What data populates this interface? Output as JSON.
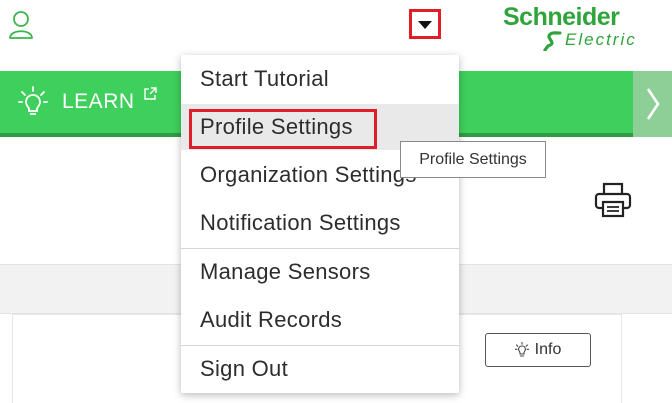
{
  "header": {
    "user_icon": "user-icon",
    "menu_trigger_icon": "caret-down-icon",
    "logo": {
      "line1": "Schneider",
      "line2": "Electric"
    },
    "accent_red": "#e01e2a",
    "brand_green": "#2fa43b"
  },
  "nav": {
    "learn_label": "LEARN",
    "learn_icon": "lightbulb-icon",
    "external_icon": "external-link-icon",
    "next_icon": "chevron-right-icon",
    "bar_color": "#3ecf5c"
  },
  "dropdown": {
    "items": [
      {
        "label": "Start Tutorial"
      },
      {
        "label": "Profile Settings"
      },
      {
        "label": "Organization Settings"
      },
      {
        "label": "Notification Settings"
      },
      {
        "label": "Manage Sensors"
      },
      {
        "label": "Audit Records"
      },
      {
        "label": "Sign Out"
      }
    ]
  },
  "tooltip": {
    "text": "Profile Settings"
  },
  "content": {
    "print_icon": "printer-icon",
    "info_button_label": "Info",
    "info_icon": "lightbulb-icon"
  }
}
